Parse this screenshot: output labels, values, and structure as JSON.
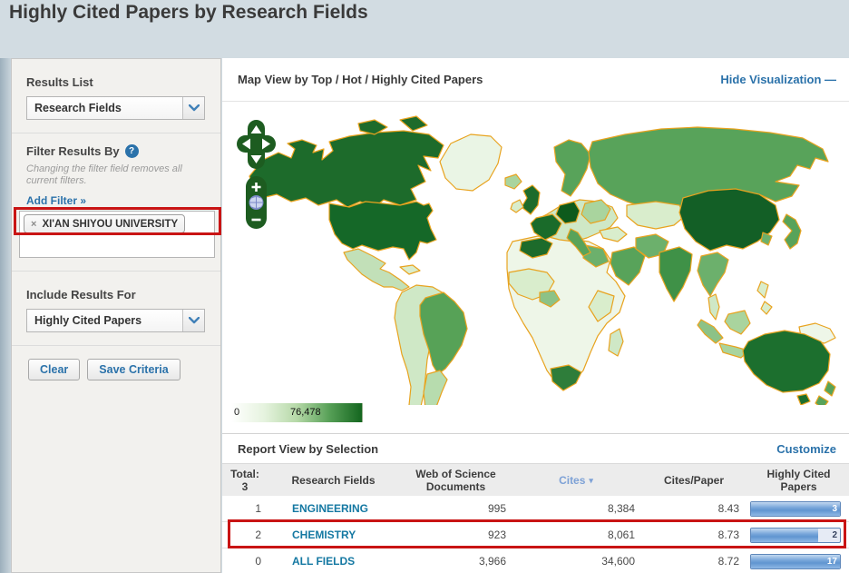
{
  "page": {
    "title": "Highly Cited Papers by Research Fields"
  },
  "sidebar": {
    "results_list": {
      "label": "Results List",
      "selected": "Research Fields"
    },
    "filter": {
      "heading": "Filter Results By",
      "help_icon": "?",
      "note_line1": "Changing the filter field removes all",
      "note_line2": "current filters.",
      "add_filter_label": "Add Filter »",
      "tag": {
        "remove_icon": "×",
        "label": "XI'AN SHIYOU UNIVERSITY"
      }
    },
    "include": {
      "label": "Include Results For",
      "selected": "Highly Cited Papers"
    },
    "buttons": {
      "clear": "Clear",
      "save": "Save Criteria"
    }
  },
  "map_section": {
    "title": "Map View by Top / Hot / Highly Cited Papers",
    "hide_link": "Hide Visualization —",
    "legend": {
      "min": "0",
      "max": "76,478"
    },
    "region_colors": {
      "canada": "#1d6b2b",
      "usa": "#156828",
      "greenland": "#eaf5e5",
      "iceland": "#a9d49e",
      "mexico": "#c2e0b8",
      "south_america": "#cfe8c6",
      "brazil": "#57a257",
      "argentina": "#b7dcae",
      "africa": "#eef6e8",
      "africa_west": "#d9edcc",
      "nigeria": "#8cc287",
      "egypt": "#6cb06c",
      "africa_east": "#d9edcc",
      "south_africa": "#2e7d3a",
      "madagascar": "#cfe8c6",
      "europe": "#cfe8c6",
      "uk": "#1d6b2b",
      "ireland": "#d9edcc",
      "scandinavia": "#58a35a",
      "france": "#1a6b2a",
      "germany": "#0d5a1c",
      "spain": "#1d6b2b",
      "italy": "#58a35a",
      "east_europe": "#a9d49e",
      "russia": "#58a35a",
      "central_asia": "#d9edcc",
      "mongolia": "#cfe8c6",
      "turkey": "#d9edcc",
      "saudi": "#58a35a",
      "iran": "#6cb06c",
      "india": "#3f9147",
      "china": "#135f26",
      "korea": "#6cb06c",
      "japan": "#58a35a",
      "se_asia": "#6cb06c",
      "malay": "#cfe8c6",
      "borneo": "#a9d49e",
      "sumatra": "#8cc287",
      "java": "#a9d49e",
      "new_guinea": "#eef6e8",
      "australia": "#1c6f2e",
      "new_zealand": "#58a35a"
    }
  },
  "report": {
    "title": "Report View by Selection",
    "customize_link": "Customize",
    "table": {
      "total_label": "Total:",
      "total_value": "3",
      "headers": {
        "field": "Research Fields",
        "docs_line1": "Web of Science",
        "docs_line2": "Documents",
        "cites": "Cites",
        "sort_arrow": "▾",
        "cites_per_paper": "Cites/Paper",
        "hcp_line1": "Highly Cited",
        "hcp_line2": "Papers"
      },
      "rows": [
        {
          "rank": "1",
          "field": "ENGINEERING",
          "docs": "995",
          "cites": "8,384",
          "cites_per_paper": "8.43",
          "hcp": "3",
          "bar_pct": 100
        },
        {
          "rank": "2",
          "field": "CHEMISTRY",
          "docs": "923",
          "cites": "8,061",
          "cites_per_paper": "8.73",
          "hcp": "2",
          "bar_pct": 76
        },
        {
          "rank": "0",
          "field": "ALL FIELDS",
          "docs": "3,966",
          "cites": "34,600",
          "cites_per_paper": "8.72",
          "hcp": "17",
          "bar_pct": 100
        }
      ]
    }
  },
  "colors": {
    "accent_blue": "#2b72aa",
    "link_teal": "#1478a2",
    "annotation_red": "#c91414",
    "map_border_orange": "#e8a31f",
    "bar_blue": "#6095d0"
  }
}
